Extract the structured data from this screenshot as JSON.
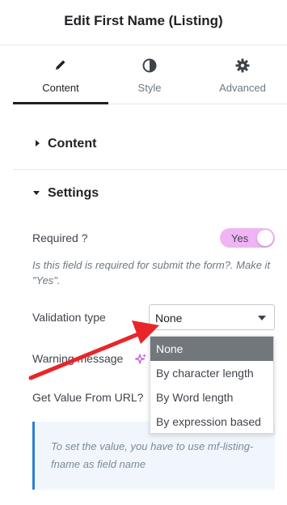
{
  "header": {
    "title": "Edit First Name (Listing)"
  },
  "tabs": [
    {
      "label": "Content",
      "icon": "pencil-icon",
      "active": true
    },
    {
      "label": "Style",
      "icon": "contrast-icon",
      "active": false
    },
    {
      "label": "Advanced",
      "icon": "gear-icon",
      "active": false
    }
  ],
  "sections": {
    "content": {
      "title": "Content",
      "expanded": false
    },
    "settings": {
      "title": "Settings",
      "expanded": true
    }
  },
  "settings": {
    "required_label": "Required ?",
    "required_toggle": "Yes",
    "required_help": "Is this field is required for submit the form?. Make it \"Yes\".",
    "validation_label": "Validation type",
    "validation_value": "None",
    "validation_options": [
      "None",
      "By character length",
      "By Word length",
      "By expression based"
    ],
    "warning_label": "Warning message",
    "get_value_label": "Get Value From URL?",
    "info_text": "To set the value, you have to use mf-listing-fname as field name"
  },
  "colors": {
    "toggle_bg": "#f0b4f4",
    "selected_option_bg": "#72777c",
    "info_border": "#2d7fd6",
    "annotation_arrow": "#e8262a"
  }
}
